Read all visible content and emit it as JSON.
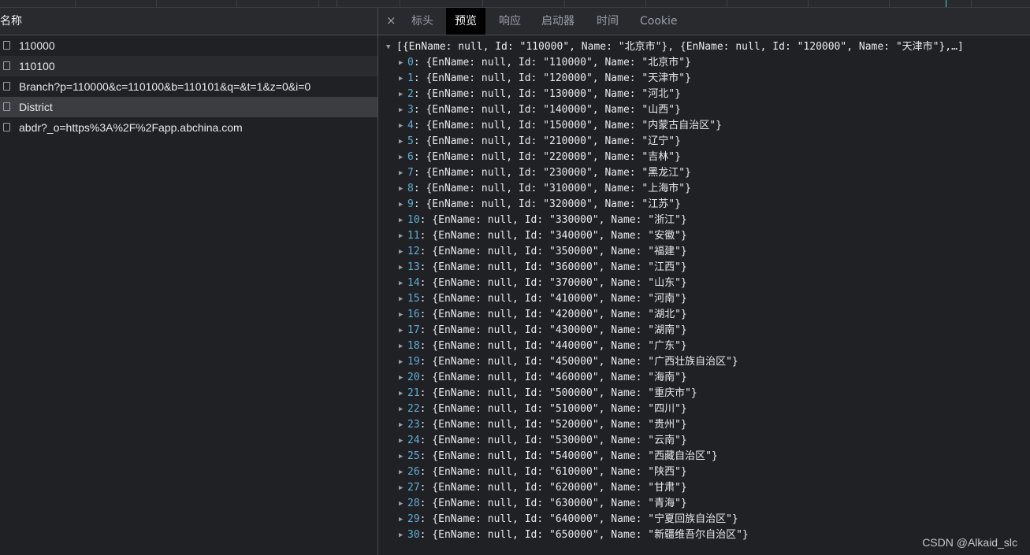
{
  "left_panel": {
    "header": "名称",
    "requests": [
      {
        "name": "110000"
      },
      {
        "name": "110100"
      },
      {
        "name": "Branch?p=110000&c=110100&b=110101&q=&t=1&z=0&i=0"
      },
      {
        "name": "District",
        "selected": true
      },
      {
        "name": "abdr?_o=https%3A%2F%2Fapp.abchina.com"
      }
    ]
  },
  "tabs": {
    "close_symbol": "×",
    "items": [
      "标头",
      "预览",
      "响应",
      "启动器",
      "时间",
      "Cookie"
    ],
    "active": "预览"
  },
  "preview": {
    "summary": "[{EnName: null, Id: \"110000\", Name: \"北京市\"}, {EnName: null, Id: \"120000\", Name: \"天津市\"},…]",
    "items": [
      {
        "idx": "0",
        "id": "110000",
        "name": "北京市"
      },
      {
        "idx": "1",
        "id": "120000",
        "name": "天津市"
      },
      {
        "idx": "2",
        "id": "130000",
        "name": "河北"
      },
      {
        "idx": "3",
        "id": "140000",
        "name": "山西"
      },
      {
        "idx": "4",
        "id": "150000",
        "name": "内蒙古自治区"
      },
      {
        "idx": "5",
        "id": "210000",
        "name": "辽宁"
      },
      {
        "idx": "6",
        "id": "220000",
        "name": "吉林"
      },
      {
        "idx": "7",
        "id": "230000",
        "name": "黑龙江"
      },
      {
        "idx": "8",
        "id": "310000",
        "name": "上海市"
      },
      {
        "idx": "9",
        "id": "320000",
        "name": "江苏"
      },
      {
        "idx": "10",
        "id": "330000",
        "name": "浙江"
      },
      {
        "idx": "11",
        "id": "340000",
        "name": "安徽"
      },
      {
        "idx": "12",
        "id": "350000",
        "name": "福建"
      },
      {
        "idx": "13",
        "id": "360000",
        "name": "江西"
      },
      {
        "idx": "14",
        "id": "370000",
        "name": "山东"
      },
      {
        "idx": "15",
        "id": "410000",
        "name": "河南"
      },
      {
        "idx": "16",
        "id": "420000",
        "name": "湖北"
      },
      {
        "idx": "17",
        "id": "430000",
        "name": "湖南"
      },
      {
        "idx": "18",
        "id": "440000",
        "name": "广东"
      },
      {
        "idx": "19",
        "id": "450000",
        "name": "广西壮族自治区"
      },
      {
        "idx": "20",
        "id": "460000",
        "name": "海南"
      },
      {
        "idx": "21",
        "id": "500000",
        "name": "重庆市"
      },
      {
        "idx": "22",
        "id": "510000",
        "name": "四川"
      },
      {
        "idx": "23",
        "id": "520000",
        "name": "贵州"
      },
      {
        "idx": "24",
        "id": "530000",
        "name": "云南"
      },
      {
        "idx": "25",
        "id": "540000",
        "name": "西藏自治区"
      },
      {
        "idx": "26",
        "id": "610000",
        "name": "陕西"
      },
      {
        "idx": "27",
        "id": "620000",
        "name": "甘肃"
      },
      {
        "idx": "28",
        "id": "630000",
        "name": "青海"
      },
      {
        "idx": "29",
        "id": "640000",
        "name": "宁夏回族自治区"
      },
      {
        "idx": "30",
        "id": "650000",
        "name": "新疆维吾尔自治区"
      }
    ]
  },
  "watermark": "CSDN @Alkaid_slc",
  "colors": {
    "background": "#202124",
    "key_blue": "#5db0d7",
    "active_tab": "#000000",
    "selected_row": "#3c3d40"
  },
  "icons": {
    "expand": "triangle-down-icon",
    "collapsed": "triangle-right-icon",
    "checkbox": "checkbox-icon",
    "close": "close-icon"
  }
}
